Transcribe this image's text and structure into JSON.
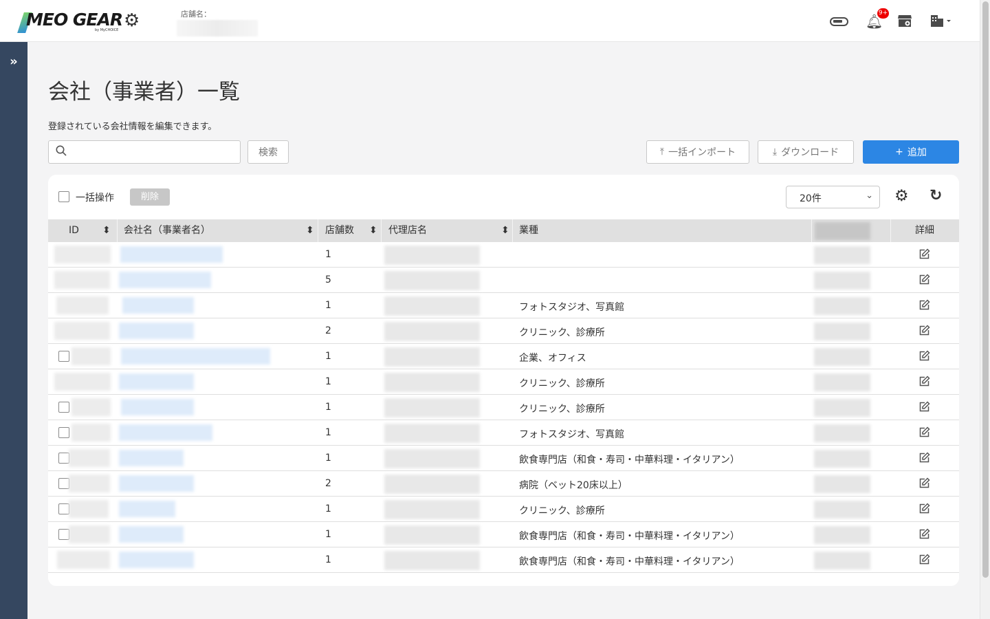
{
  "header": {
    "logo_text": "MEO GEAR",
    "logo_sub": "by MyCHOICE",
    "store_label": "店舗名：",
    "notification_count": "9+"
  },
  "page": {
    "title": "会社（事業者）一覧",
    "description": "登録されている会社情報を編集できます。"
  },
  "toolbar": {
    "search_placeholder": "",
    "search_button": "検索",
    "import_button": "一括インポート",
    "download_button": "ダウンロード",
    "add_button": "追加"
  },
  "table_controls": {
    "bulk_label": "一括操作",
    "delete_button": "削除",
    "page_size": "20件"
  },
  "table": {
    "columns": [
      "ID",
      "会社名（事業者名）",
      "店舗数",
      "代理店名",
      "業種",
      "",
      "詳細"
    ],
    "rows": [
      {
        "stores": "1",
        "industry": "",
        "checkbox": false
      },
      {
        "stores": "5",
        "industry": "",
        "checkbox": false
      },
      {
        "stores": "1",
        "industry": "フォトスタジオ、写真館",
        "checkbox": false
      },
      {
        "stores": "2",
        "industry": "クリニック、診療所",
        "checkbox": false
      },
      {
        "stores": "1",
        "industry": "企業、オフィス",
        "checkbox": true
      },
      {
        "stores": "1",
        "industry": "クリニック、診療所",
        "checkbox": false
      },
      {
        "stores": "1",
        "industry": "クリニック、診療所",
        "checkbox": true
      },
      {
        "stores": "1",
        "industry": "フォトスタジオ、写真館",
        "checkbox": true
      },
      {
        "stores": "1",
        "industry": "飲食専門店（和食・寿司・中華料理・イタリアン）",
        "checkbox": true
      },
      {
        "stores": "2",
        "industry": "病院（ベット20床以上）",
        "checkbox": true
      },
      {
        "stores": "1",
        "industry": "クリニック、診療所",
        "checkbox": true
      },
      {
        "stores": "1",
        "industry": "飲食専門店（和食・寿司・中華料理・イタリアン）",
        "checkbox": true
      },
      {
        "stores": "1",
        "industry": "飲食専門店（和食・寿司・中華料理・イタリアン）",
        "checkbox": false
      }
    ]
  }
}
